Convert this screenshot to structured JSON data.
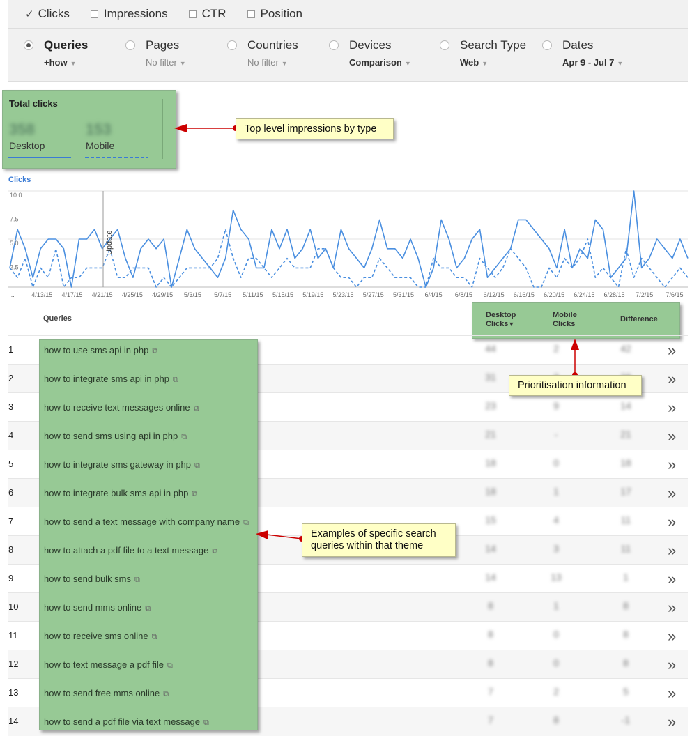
{
  "metrics": [
    {
      "label": "Clicks",
      "checked": true
    },
    {
      "label": "Impressions",
      "checked": false
    },
    {
      "label": "CTR",
      "checked": false
    },
    {
      "label": "Position",
      "checked": false
    }
  ],
  "filters": [
    {
      "name": "Queries",
      "sub": "+how",
      "selected": true
    },
    {
      "name": "Pages",
      "sub": "No filter",
      "selected": false
    },
    {
      "name": "Countries",
      "sub": "No filter",
      "selected": false
    },
    {
      "name": "Devices",
      "sub": "Comparison",
      "selected": false
    },
    {
      "name": "Search Type",
      "sub": "Web",
      "selected": false
    },
    {
      "name": "Dates",
      "sub": "Apr 9 - Jul 7",
      "selected": false
    }
  ],
  "totals": {
    "title": "Total clicks",
    "desktop_label": "Desktop",
    "desktop_value": "358",
    "mobile_label": "Mobile",
    "mobile_value": "153"
  },
  "callouts": {
    "top": "Top level impressions by type",
    "prioritisation": "Prioritisation information",
    "examples_line1": "Examples of specific search",
    "examples_line2": "queries within that theme"
  },
  "chart_data": {
    "type": "line",
    "title": "Clicks",
    "y_ticks": [
      "10.0",
      "7.5",
      "5.0",
      "2.5"
    ],
    "ylim": [
      0,
      10
    ],
    "x_ticks": [
      "...",
      "4/13/15",
      "4/17/15",
      "4/21/15",
      "4/25/15",
      "4/29/15",
      "5/3/15",
      "5/7/15",
      "5/11/15",
      "5/15/15",
      "5/19/15",
      "5/23/15",
      "5/27/15",
      "5/31/15",
      "6/4/15",
      "6/8/15",
      "6/12/15",
      "6/16/15",
      "6/20/15",
      "6/24/15",
      "6/28/15",
      "7/2/15",
      "7/6/15"
    ],
    "annotation": "Update",
    "series": [
      {
        "name": "Desktop",
        "color": "#4a8fe0",
        "dashed": false,
        "values": [
          2,
          6,
          4,
          1,
          4,
          5,
          5,
          4,
          0,
          5,
          5,
          6,
          4,
          5,
          6,
          3,
          1,
          4,
          5,
          4,
          5,
          0,
          3,
          6,
          4,
          3,
          2,
          1,
          3,
          8,
          6,
          5,
          2,
          2,
          6,
          4,
          6,
          3,
          4,
          6,
          3,
          4,
          2,
          6,
          4,
          3,
          2,
          4,
          7,
          4,
          4,
          3,
          5,
          3,
          0,
          2,
          7,
          5,
          2,
          3,
          5,
          6,
          1,
          2,
          3,
          4,
          7,
          7,
          6,
          5,
          4,
          2,
          6,
          2,
          4,
          3,
          7,
          6,
          1,
          2,
          3,
          10,
          2,
          3,
          5,
          4,
          3,
          5,
          3
        ]
      },
      {
        "name": "Mobile",
        "color": "#4a8fe0",
        "dashed": true,
        "values": [
          2,
          1,
          3,
          0,
          2,
          1,
          4,
          0,
          1,
          1,
          2,
          2,
          2,
          4,
          1,
          1,
          2,
          2,
          2,
          0,
          1,
          0,
          1,
          2,
          2,
          2,
          2,
          3,
          6,
          3,
          1,
          3,
          3,
          2,
          1,
          2,
          3,
          2,
          2,
          2,
          4,
          4,
          2,
          1,
          1,
          0,
          1,
          1,
          3,
          2,
          1,
          1,
          1,
          0,
          0,
          3,
          2,
          2,
          1,
          1,
          0,
          3,
          2,
          1,
          2,
          4,
          3,
          2,
          0,
          0,
          2,
          1,
          3,
          2,
          3,
          5,
          1,
          2,
          1,
          0,
          4,
          1,
          3,
          2,
          1,
          0,
          1,
          2,
          1
        ]
      }
    ]
  },
  "table": {
    "col_queries": "Queries",
    "col_desktop_l1": "Desktop",
    "col_desktop_l2": "Clicks",
    "col_mobile_l1": "Mobile",
    "col_mobile_l2": "Clicks",
    "col_difference": "Difference",
    "rows": [
      {
        "n": "1",
        "q": "how to use sms api in php",
        "d": "44",
        "m": "2",
        "diff": "42"
      },
      {
        "n": "2",
        "q": "how to integrate sms api in php",
        "d": "31",
        "m": "3",
        "diff": "28"
      },
      {
        "n": "3",
        "q": "how to receive text messages online",
        "d": "23",
        "m": "9",
        "diff": "14"
      },
      {
        "n": "4",
        "q": "how to send sms using api in php",
        "d": "21",
        "m": "-",
        "diff": "21"
      },
      {
        "n": "5",
        "q": "how to integrate sms gateway in php",
        "d": "18",
        "m": "0",
        "diff": "18"
      },
      {
        "n": "6",
        "q": "how to integrate bulk sms api in php",
        "d": "18",
        "m": "1",
        "diff": "17"
      },
      {
        "n": "7",
        "q": "how to send a text message with company name",
        "d": "15",
        "m": "4",
        "diff": "11"
      },
      {
        "n": "8",
        "q": "how to attach a pdf file to a text message",
        "d": "14",
        "m": "3",
        "diff": "11"
      },
      {
        "n": "9",
        "q": "how to send bulk sms",
        "d": "14",
        "m": "13",
        "diff": "1"
      },
      {
        "n": "10",
        "q": "how to send mms online",
        "d": "8",
        "m": "1",
        "diff": "8"
      },
      {
        "n": "11",
        "q": "how to receive sms online",
        "d": "8",
        "m": "0",
        "diff": "8"
      },
      {
        "n": "12",
        "q": "how to text message a pdf file",
        "d": "8",
        "m": "0",
        "diff": "8"
      },
      {
        "n": "13",
        "q": "how to send free mms online",
        "d": "7",
        "m": "2",
        "diff": "5"
      },
      {
        "n": "14",
        "q": "how to send a pdf file via text message",
        "d": "7",
        "m": "8",
        "diff": "-1"
      }
    ]
  }
}
